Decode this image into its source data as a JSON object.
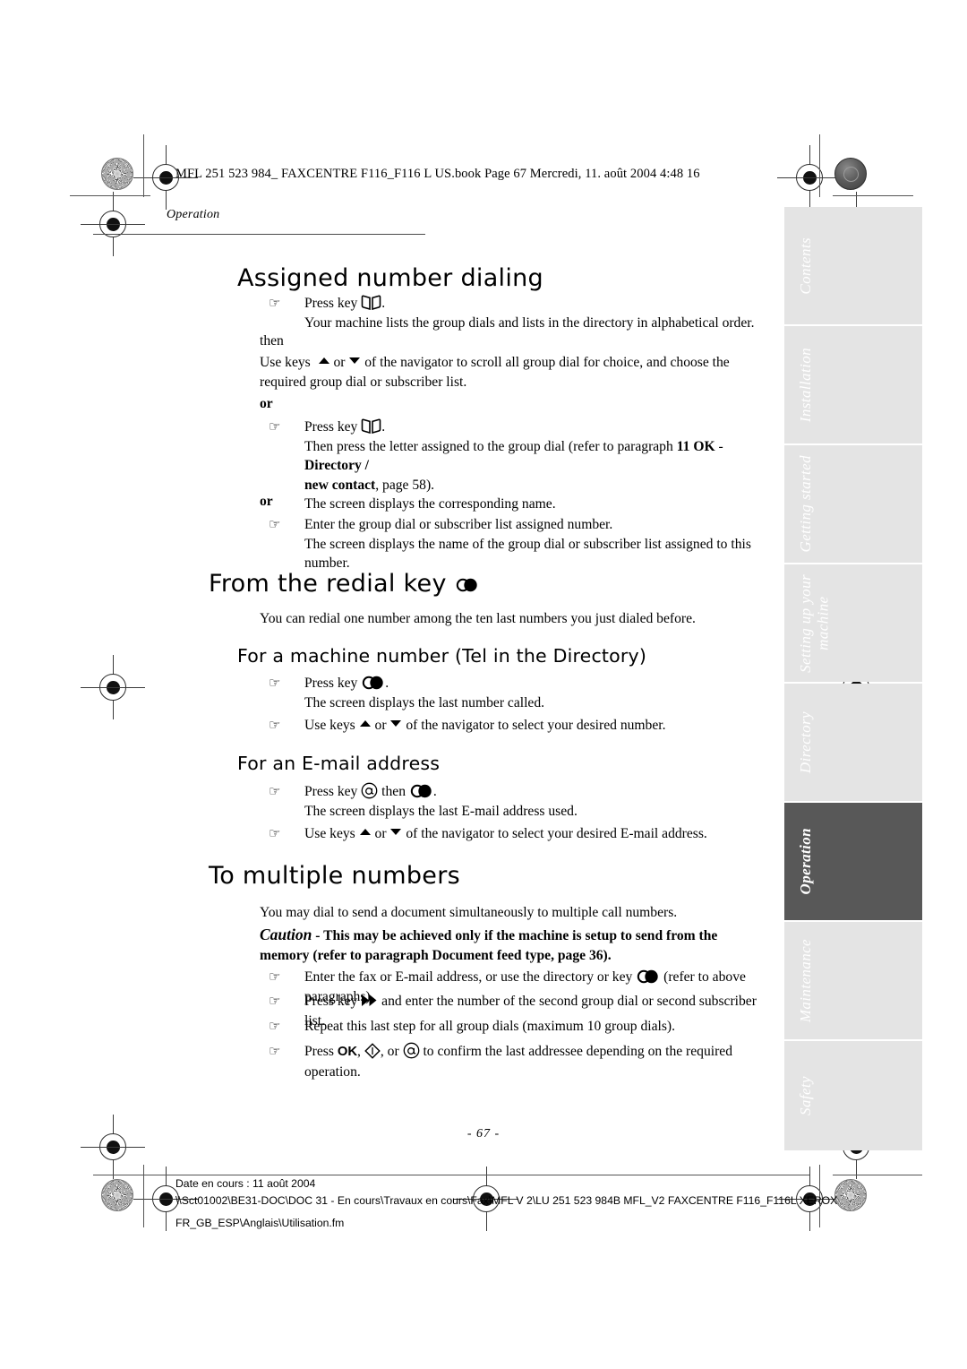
{
  "header": {
    "book_line": "MFL 251 523 984_ FAXCENTRE F116_F116 L US.book  Page 67  Mercredi, 11. août 2004  4:48 16",
    "running_head": "Operation"
  },
  "sidebar": {
    "tabs": [
      {
        "label": "Contents",
        "active": false
      },
      {
        "label": "Installation",
        "active": false
      },
      {
        "label": "Getting started",
        "active": false
      },
      {
        "label": "Setting up your\nmachine",
        "active": false
      },
      {
        "label": "Directory",
        "active": false
      },
      {
        "label": "Operation",
        "active": true
      },
      {
        "label": "Maintenance",
        "active": false
      },
      {
        "label": "Safety",
        "active": false
      }
    ],
    "active_color": "#585858",
    "inactive_color": "#e4e4e4",
    "label_color": "#ffffff"
  },
  "content": {
    "section1": {
      "title": "Assigned number dialing",
      "b1_prefix": "Press key",
      "b1_suffix": ".",
      "b1_line2": "Your machine lists the group dials and lists in the directory in  alphabetical order.",
      "then_label": "then",
      "use_keys_pre": "Use keys",
      "use_keys_mid": "or",
      "use_keys_post": "of the navigator to scroll all group dial for choice, and choose the required group dial or subscriber list.",
      "or_label_1": "or",
      "b2_prefix": "Press key",
      "b2_suffix": ".",
      "b2_line2_a": "Then press the letter assigned to the group dial (refer to paragraph ",
      "b2_line2_bold1": "11 OK",
      "b2_line2_b": " - ",
      "b2_line2_bold2": "Directory /",
      "b2_line3_bold": " new contact",
      "b2_line3_rest": ", page 58).",
      "b2_line4": "The screen displays the corresponding name.",
      "or_label_2": "or",
      "b3_line1": "Enter the group dial or subscriber list  assigned number.",
      "b3_line2": "The screen displays the name of the group dial or subscriber list assigned to this number."
    },
    "section2": {
      "title": "From the redial key",
      "intro": "You can redial one number among the ten last numbers you just dialed before.",
      "sub1": {
        "title": "For a machine number (Tel in the Directory)",
        "b1_prefix": "Press key",
        "b1_suffix": ".",
        "b1_line2": "The screen displays the last number called.",
        "b2_pre": "Use keys",
        "b2_mid": "or",
        "b2_post": "of the navigator to select your desired number."
      },
      "sub2": {
        "title": "For an E-mail address",
        "b1_pre": "Press key",
        "b1_mid": "then",
        "b1_suffix": ".",
        "b1_line2": "The screen displays the last E-mail address used.",
        "b2_pre": "Use keys",
        "b2_mid": "or",
        "b2_post": "of the navigator to select your desired E-mail address."
      }
    },
    "section3": {
      "title": "To multiple numbers",
      "intro": "You may dial to send a document simultaneously to multiple call numbers.",
      "caution_word": "Caution",
      "caution_text": " - This may be achieved only if the machine is setup to send from the memory (refer to paragraph Document feed type, page 36).",
      "b1_pre": "Enter the fax or E-mail address, or use the directory or key",
      "b1_post": "(refer to above paragraphs).",
      "b2_pre": "Press key",
      "b2_post": "and enter the number of the second group dial or second subscriber list.",
      "b3": "Repeat this last step for all group dials (maximum 10 group dials).",
      "b4_pre": "Press",
      "b4_ok": "OK",
      "b4_mid1": ",",
      "b4_mid2": ", or",
      "b4_post": "to confirm the last addressee depending on the required operation."
    }
  },
  "footer": {
    "page_number": "- 67 -",
    "line1": "Date en cours : 11 août 2004",
    "line2": "\\\\Sct01002\\BE31-DOC\\DOC 31 - En cours\\Travaux en cours\\Fax\\MFL V 2\\LU 251 523 984B MFL_V2 FAXCENTRE F116_F116L XEROX",
    "line3": "FR_GB_ESP\\Anglais\\Utilisation.fm"
  },
  "icons": {
    "directory_book": "book-icon",
    "redial": "redial-key-icon",
    "at": "at-key-icon",
    "diamond": "diamond-key-icon",
    "fast_forward": "fast-forward-key-icon",
    "nav_up": "nav-up-arrow-icon",
    "nav_down": "nav-down-arrow-icon",
    "hand": "pointing-hand-bullet-icon"
  }
}
